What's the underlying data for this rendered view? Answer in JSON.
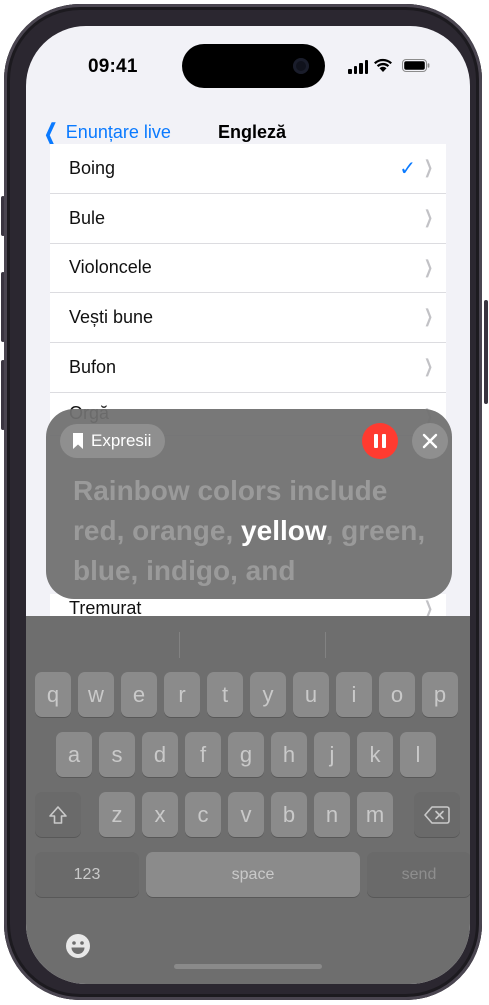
{
  "status_bar": {
    "time": "09:41"
  },
  "nav": {
    "back_label": "Enunțare live",
    "title": "Engleză"
  },
  "sound_list": {
    "items": [
      {
        "label": "Boing",
        "selected": true
      },
      {
        "label": "Bule",
        "selected": false
      },
      {
        "label": "Violoncele",
        "selected": false
      },
      {
        "label": "Vești bune",
        "selected": false
      },
      {
        "label": "Bufon",
        "selected": false
      },
      {
        "label": "Orgă",
        "selected": false
      }
    ],
    "partial_bottom_item": "Tremurat"
  },
  "live_speech_panel": {
    "phrases_label": "Expresii",
    "text_before": "Rainbow colors include red, orange, ",
    "text_current": "yellow",
    "text_after": ", green, blue, indigo, and"
  },
  "keyboard": {
    "row1": [
      "q",
      "w",
      "e",
      "r",
      "t",
      "y",
      "u",
      "i",
      "o",
      "p"
    ],
    "row2": [
      "a",
      "s",
      "d",
      "f",
      "g",
      "h",
      "j",
      "k",
      "l"
    ],
    "row3": [
      "z",
      "x",
      "c",
      "v",
      "b",
      "n",
      "m"
    ],
    "numbers_label": "123",
    "space_label": "space",
    "send_label": "send"
  },
  "colors": {
    "accent": "#0a7aff",
    "pause": "#ff3b30"
  },
  "icons": [
    "chevron-left-icon",
    "checkmark-icon",
    "chevron-right-icon",
    "bookmark-icon",
    "pause-icon",
    "close-icon",
    "shift-icon",
    "delete-icon",
    "emoji-icon",
    "signal-icon",
    "wifi-icon",
    "battery-icon"
  ]
}
